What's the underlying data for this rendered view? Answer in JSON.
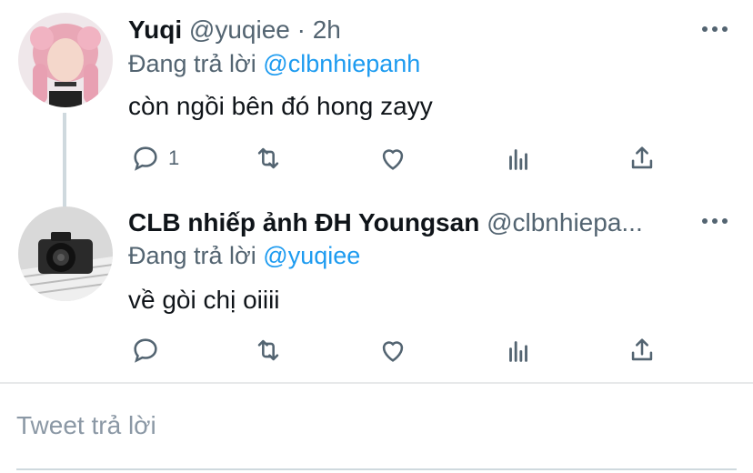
{
  "tweets": [
    {
      "name": "Yuqi",
      "handle": "@yuqiee",
      "sep": "·",
      "time": "2h",
      "reply_prefix": "Đang trả lời",
      "reply_to": "@clbnhiepanh",
      "text": "còn ngồi bên đó hong zayy",
      "reply_count": "1"
    },
    {
      "name": "CLB nhiếp ảnh ĐH Youngsan",
      "handle": "@clbnhiepa...",
      "reply_prefix": "Đang trả lời",
      "reply_to": "@yuqiee",
      "text": "về gòi chị oiiii",
      "reply_count": ""
    }
  ],
  "composer": {
    "placeholder": "Tweet trả lời"
  },
  "icons": [
    "reply-icon",
    "retweet-icon",
    "like-icon",
    "analytics-icon",
    "share-icon",
    "more-icon"
  ],
  "colors": {
    "accent": "#1d9bf0",
    "muted": "#536471",
    "divider": "#e7e9ea"
  }
}
